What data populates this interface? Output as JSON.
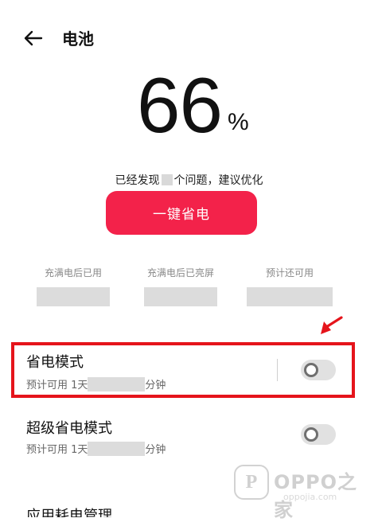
{
  "header": {
    "title": "电池"
  },
  "battery": {
    "percent": "66",
    "percent_sign": "%"
  },
  "issues": {
    "text_before": "已经发现",
    "text_after": "个问题，建议优化"
  },
  "optimize_button": {
    "label": "一键省电"
  },
  "stats": [
    {
      "label": "充满电后已用"
    },
    {
      "label": "充满电后已亮屏"
    },
    {
      "label": "预计还可用"
    }
  ],
  "settings": {
    "power_saving": {
      "title": "省电模式",
      "sub_prefix": "预计可用 1天",
      "sub_suffix": "分钟",
      "enabled": false
    },
    "super_power_saving": {
      "title": "超级省电模式",
      "sub_prefix": "预计可用 1天",
      "sub_suffix": "分钟",
      "enabled": false
    },
    "next_item_partial": "应用耗电管理"
  },
  "watermark": {
    "brand": "OPPO之家",
    "url": "oppojia.com"
  },
  "colors": {
    "accent": "#f3224a",
    "highlight": "#e5141b"
  }
}
